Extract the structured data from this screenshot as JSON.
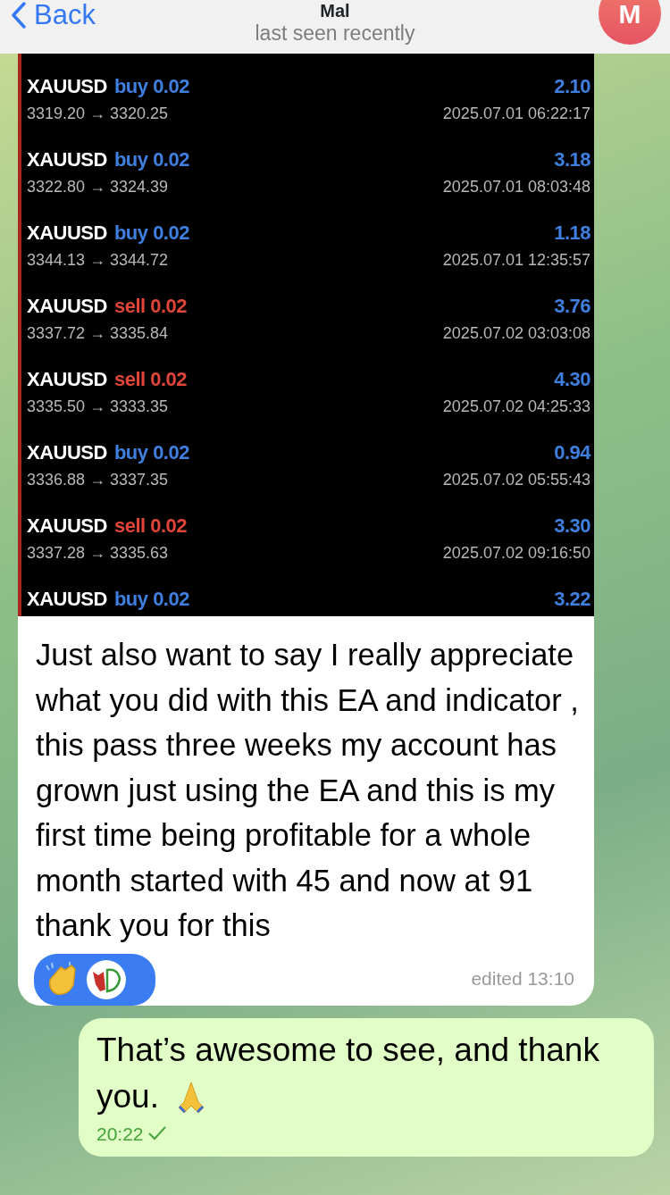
{
  "header": {
    "back_label": "Back",
    "title": "Mal",
    "subtitle": "last seen recently",
    "avatar_letter": "M"
  },
  "incoming": {
    "trades": [
      {
        "symbol": "XAUUSD",
        "side": "buy",
        "lot": "0.02",
        "profit": "2.10",
        "prices": "3319.20 → 3320.25",
        "time": "2025.07.01 06:22:17"
      },
      {
        "symbol": "XAUUSD",
        "side": "buy",
        "lot": "0.02",
        "profit": "3.18",
        "prices": "3322.80 → 3324.39",
        "time": "2025.07.01 08:03:48"
      },
      {
        "symbol": "XAUUSD",
        "side": "buy",
        "lot": "0.02",
        "profit": "1.18",
        "prices": "3344.13 → 3344.72",
        "time": "2025.07.01 12:35:57"
      },
      {
        "symbol": "XAUUSD",
        "side": "sell",
        "lot": "0.02",
        "profit": "3.76",
        "prices": "3337.72 → 3335.84",
        "time": "2025.07.02 03:03:08"
      },
      {
        "symbol": "XAUUSD",
        "side": "sell",
        "lot": "0.02",
        "profit": "4.30",
        "prices": "3335.50 → 3333.35",
        "time": "2025.07.02 04:25:33"
      },
      {
        "symbol": "XAUUSD",
        "side": "buy",
        "lot": "0.02",
        "profit": "0.94",
        "prices": "3336.88 → 3337.35",
        "time": "2025.07.02 05:55:43"
      },
      {
        "symbol": "XAUUSD",
        "side": "sell",
        "lot": "0.02",
        "profit": "3.30",
        "prices": "3337.28 → 3335.63",
        "time": "2025.07.02 09:16:50"
      },
      {
        "symbol": "XAUUSD",
        "side": "buy",
        "lot": "0.02",
        "profit": "3.22"
      }
    ],
    "text": "Just also want to say I really appreciate what you did with this EA and indicator , this pass three weeks my account has grown just using the EA and this is my first time being profitable for a whole month started with 45 and now at 91 thank you for this",
    "meta": "edited 13:10"
  },
  "outgoing": {
    "text": "That’s awesome to see, and thank you.",
    "time": "20:22"
  }
}
